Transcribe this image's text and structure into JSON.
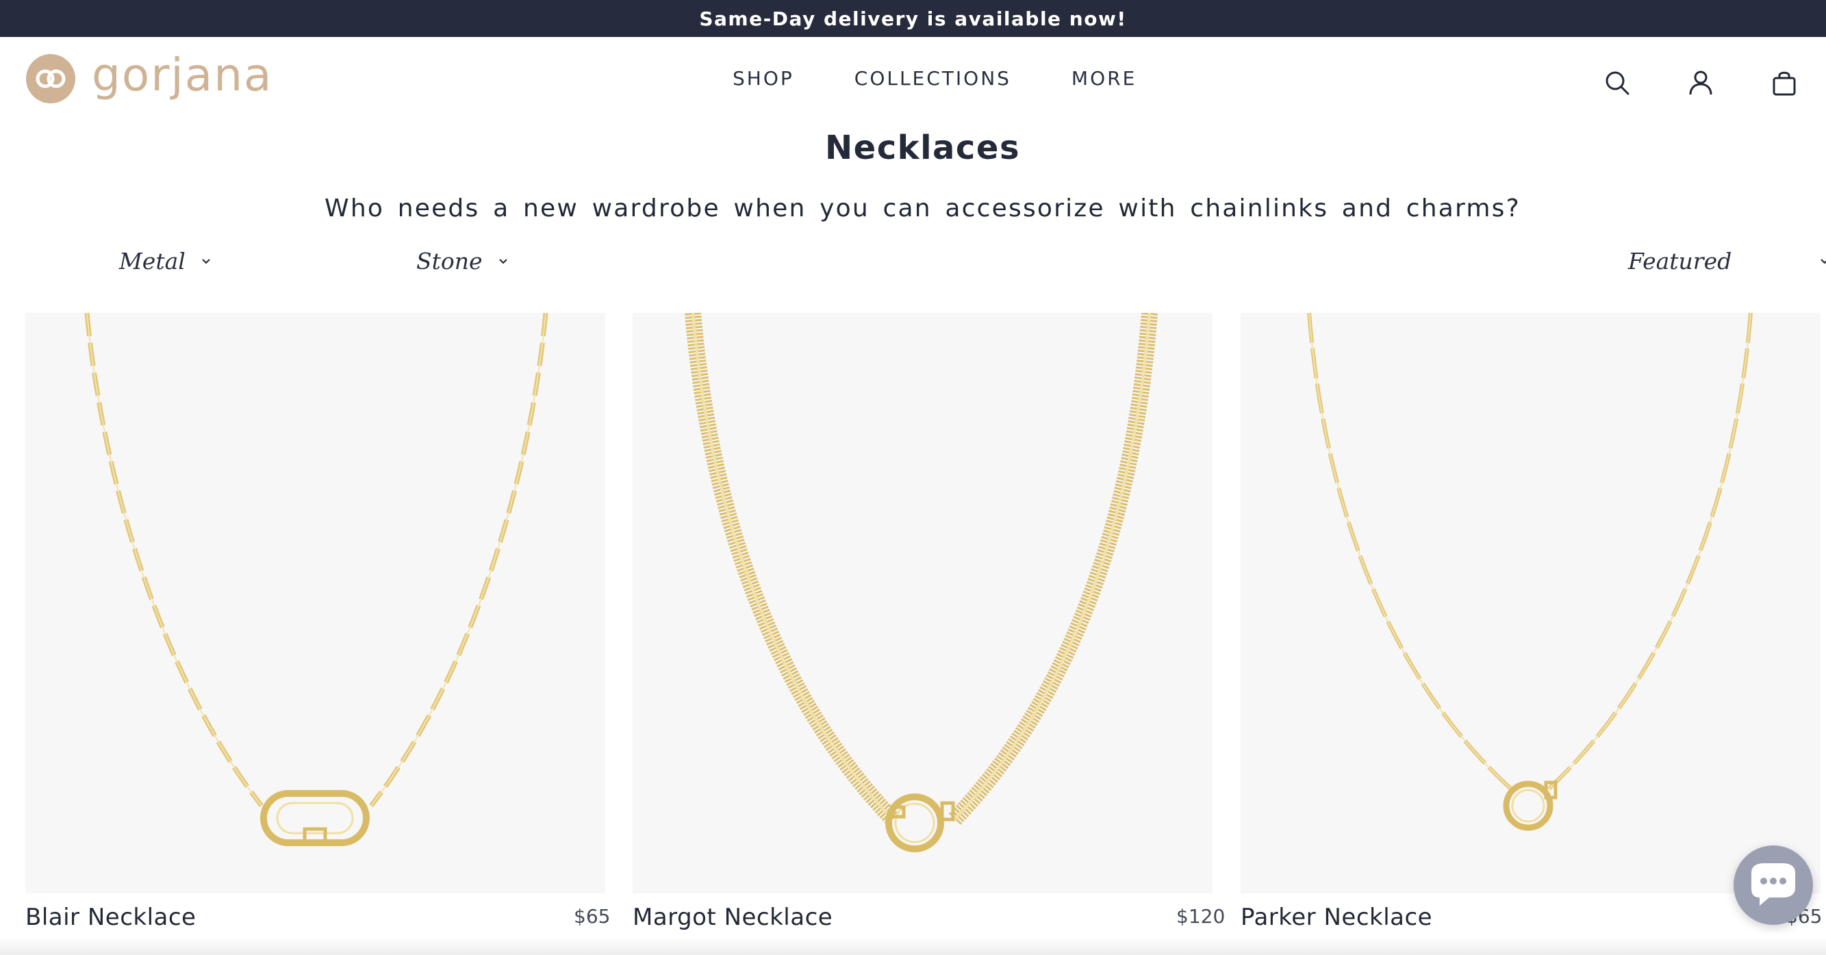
{
  "announcement": {
    "text": "Same-Day delivery is available now!"
  },
  "header": {
    "logo_text": "gorjana",
    "nav": [
      {
        "label": "SHOP"
      },
      {
        "label": "COLLECTIONS"
      },
      {
        "label": "MORE"
      }
    ],
    "icons": [
      "search-icon",
      "account-icon",
      "bag-icon"
    ]
  },
  "page": {
    "title": "Necklaces",
    "subtitle": "Who needs a new wardrobe when you can accessorize with chainlinks and charms?"
  },
  "filters": {
    "metal_label": "Metal",
    "stone_label": "Stone",
    "sort_label": "Featured"
  },
  "products": [
    {
      "name": "Blair Necklace",
      "price": "$65"
    },
    {
      "name": "Margot Necklace",
      "price": "$120"
    },
    {
      "name": "Parker Necklace",
      "price": "$65"
    }
  ],
  "colors": {
    "announcement_bg": "#262b3d",
    "brand_gold": "#cfb394",
    "product_bg": "#f7f7f7",
    "chain_gold": "#e3c77a",
    "chat_button": "#9aa0b2"
  },
  "chat": {
    "icon": "chat-bubble-icon"
  }
}
